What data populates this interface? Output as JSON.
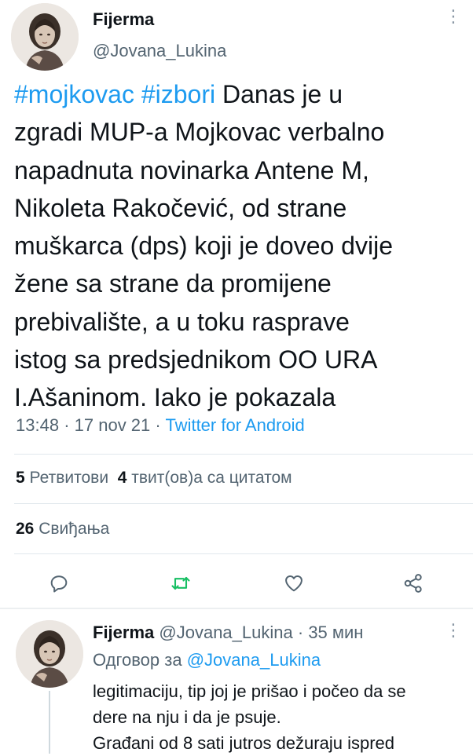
{
  "tweet": {
    "author_name": "Fijerma",
    "author_handle": "@Jovana_Lukina",
    "hashtag_1": "#mojkovac",
    "hashtag_2": "#izbori",
    "text": " Danas je u\nzgradi MUP-a Mojkovac verbalno\nnapadnuta novinarka Antene M,\nNikoleta Rakočević, od strane\nmuškarca (dps) koji je doveo dvije\nžene sa strane da promijene\nprebivalište, a u toku rasprave\nistog sa predsjednikom  OO URA\nI.Ašaninom. Iako je pokazala",
    "time": "13:48",
    "date": "17 nov 21",
    "separator": "·",
    "source": "Twitter for Android",
    "retweet_count": "5",
    "retweet_label": "Ретвитови",
    "quote_count": "4",
    "quote_label": "твит(ов)а са цитатом",
    "like_count": "26",
    "like_label": "Свиђања",
    "more_icon": "⋮"
  },
  "actions": {
    "reply_icon": "reply-icon",
    "retweet_icon": "retweet-icon",
    "like_icon": "heart-icon",
    "share_icon": "share-icon",
    "retweet_color": "#17bf63",
    "icon_color": "#536471"
  },
  "reply": {
    "author_name": "Fijerma",
    "author_handle": "@Jovana_Lukina",
    "separator": "·",
    "time_ago": "35 мин",
    "replying_label": "Одговор за",
    "replying_handle": "@Jovana_Lukina",
    "text": "legitimaciju, tip joj je prišao i počeo da se\ndere na nju i da je psuje.\nGrađani od 8 sati jutros dežuraju ispred",
    "more_icon": "⋮"
  },
  "colors": {
    "link": "#1d9bf0",
    "secondary_text": "#536471",
    "primary_text": "#0f1419"
  }
}
